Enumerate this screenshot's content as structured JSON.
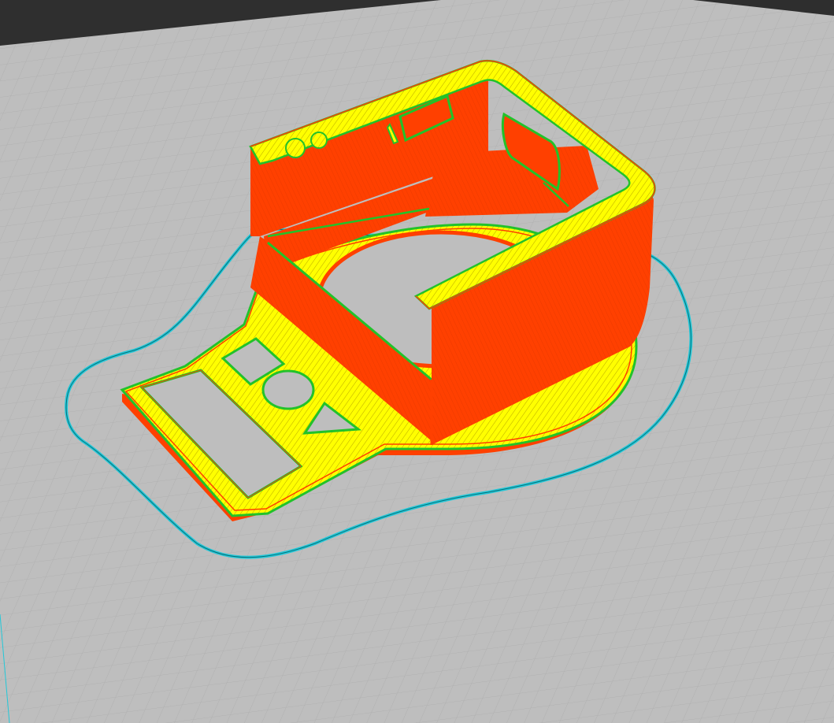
{
  "viewport": {
    "kind": "3d slicer layer preview",
    "background": "#3a3a3a",
    "build_plate": "#bdbdbd",
    "grid_line": "#a9a9a9"
  },
  "legend_colors": {
    "outer_wall": "#ff4000",
    "inner_wall": "#22c22a",
    "infill_top_skin": "#ffff00",
    "skirt": "#22c8d8"
  },
  "features": {
    "plate_cutouts": [
      "rectangle-slot",
      "square-hole",
      "circle-hole",
      "triangle-hole"
    ],
    "wall_windows": [
      "window-small",
      "window-large",
      "window-side"
    ]
  }
}
